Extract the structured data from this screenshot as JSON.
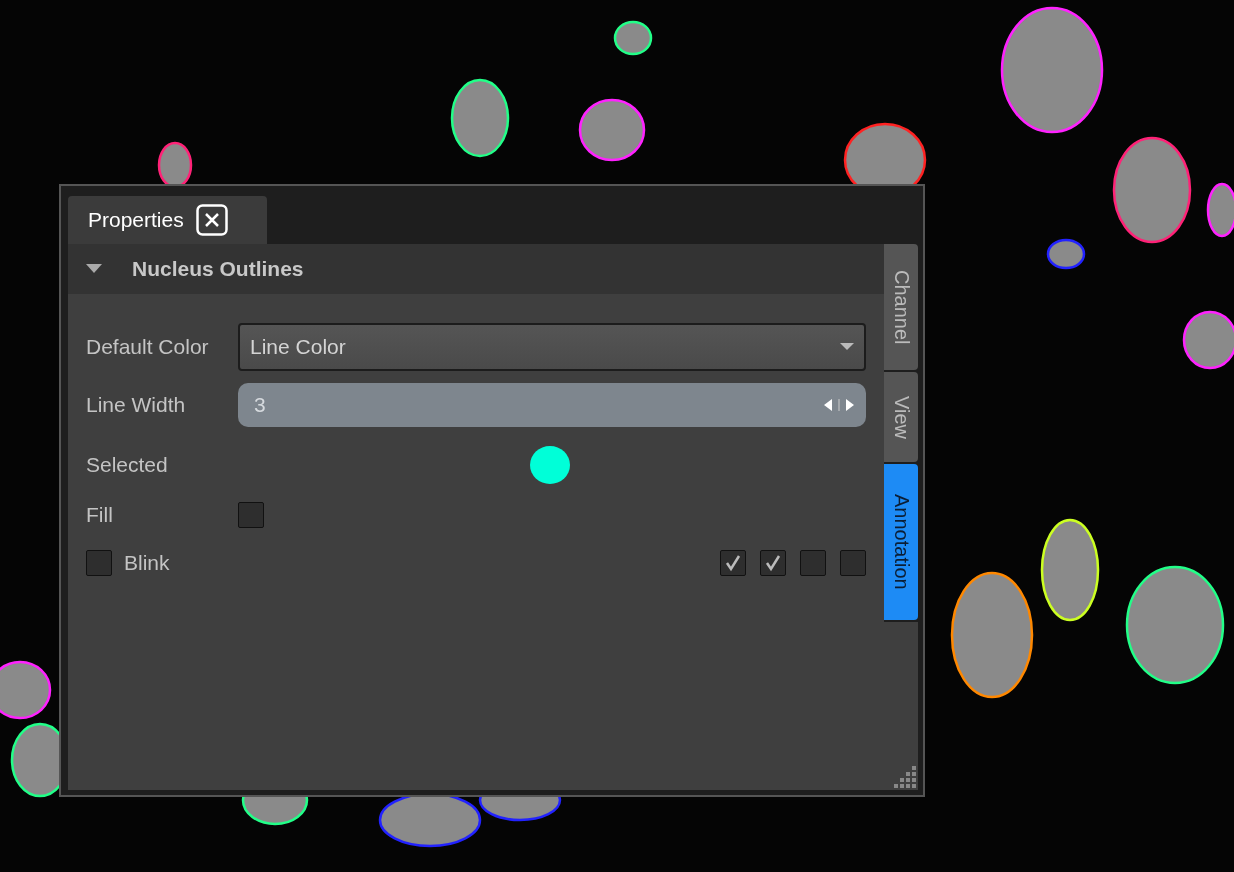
{
  "panel": {
    "tab": {
      "label": "Properties"
    },
    "section": {
      "title": "Nucleus Outlines",
      "expanded": true
    },
    "fields": [
      {
        "kind": "dropdown",
        "label": "Default Color",
        "value": "Line Color"
      },
      {
        "kind": "spinner",
        "label": "Line Width",
        "value": "3"
      },
      {
        "kind": "color",
        "label": "Selected",
        "color": "#00ffd8"
      },
      {
        "kind": "checkbox",
        "label": "Fill",
        "checked": false
      }
    ],
    "blink": {
      "label": "Blink",
      "checked": false,
      "options": [
        {
          "checked": true
        },
        {
          "checked": true
        },
        {
          "checked": false
        },
        {
          "checked": false
        }
      ]
    },
    "side_tabs": [
      {
        "label": "Channel",
        "selected": false
      },
      {
        "label": "View",
        "selected": false
      },
      {
        "label": "Annotation",
        "selected": true
      }
    ]
  }
}
